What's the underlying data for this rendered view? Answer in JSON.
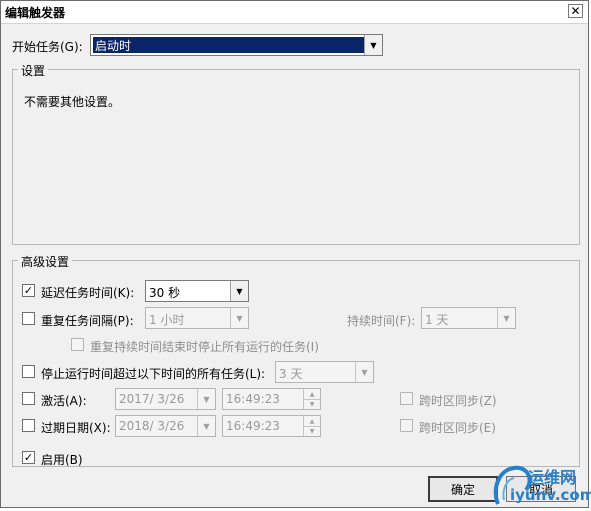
{
  "window": {
    "title": "编辑触发器",
    "close_glyph": "✕"
  },
  "begin_task": {
    "label": "开始任务(G):",
    "value": "启动时"
  },
  "settings": {
    "title": "设置",
    "text": "不需要其他设置。"
  },
  "advanced": {
    "title": "高级设置",
    "delay": {
      "label": "延迟任务时间(K):",
      "checked": true,
      "value": "30 秒"
    },
    "repeat": {
      "label": "重复任务间隔(P):",
      "checked": false,
      "value": "1 小时",
      "duration_label": "持续时间(F):",
      "duration_value": "1 天",
      "stop_label": "重复持续时间结束时停止所有运行的任务(I)"
    },
    "stop_longer": {
      "label": "停止运行时间超过以下时间的所有任务(L):",
      "checked": false,
      "value": "3 天"
    },
    "activate": {
      "label": "激活(A):",
      "checked": false,
      "date": "2017/  3/26",
      "time": "16:49:23",
      "sync_label": "跨时区同步(Z)"
    },
    "expire": {
      "label": "过期日期(X):",
      "checked": false,
      "date": "2018/  3/26",
      "time": "16:49:23",
      "sync_label": "跨时区同步(E)"
    },
    "enabled": {
      "label": "启用(B)",
      "checked": true
    }
  },
  "buttons": {
    "ok": "确定",
    "cancel": "取消"
  },
  "watermark": {
    "text_cn": "运维网",
    "text_url": "iyunv.com"
  },
  "check_glyph": "✓",
  "arrow_glyph": "▼",
  "up_glyph": "▲",
  "colors": {
    "selection": "#0a246a",
    "background": "#f0f0f0",
    "disabled_text": "#8f8f8f",
    "watermark": "#2a7fc9"
  }
}
